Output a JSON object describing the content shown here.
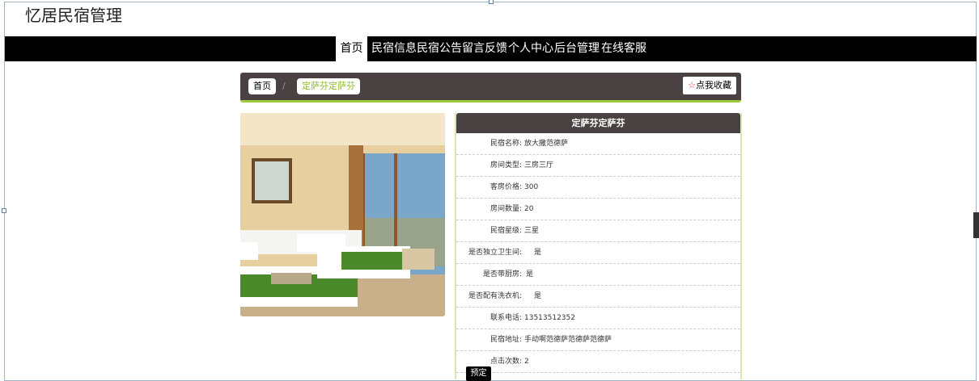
{
  "header": {
    "site_title": "忆居民宿管理"
  },
  "nav": {
    "items": [
      {
        "label": "首页",
        "active": true
      },
      {
        "label": "民宿信息"
      },
      {
        "label": "民宿公告"
      },
      {
        "label": "留言反馈"
      },
      {
        "label": "个人中心"
      },
      {
        "label": "后台管理"
      },
      {
        "label": "在线客服"
      }
    ]
  },
  "breadcrumb": {
    "home": "首页",
    "separator": "/",
    "current": "定萨芬定萨芬",
    "favorite_label": "点我收藏",
    "favorite_icon": "star-icon"
  },
  "detail": {
    "title": "定萨芬定萨芬",
    "rows": [
      {
        "label": "民宿名称:",
        "value": "放大撒范德萨"
      },
      {
        "label": "房间类型:",
        "value": "三房三厅"
      },
      {
        "label": "客房价格:",
        "value": "300"
      },
      {
        "label": "房间数量:",
        "value": "20"
      },
      {
        "label": "民宿星级:",
        "value": "三星"
      },
      {
        "label": "是否独立卫生间:",
        "value": "是"
      },
      {
        "label": "是否带厨房:",
        "value": "是"
      },
      {
        "label": "是否配有洗衣机:",
        "value": "是"
      },
      {
        "label": "联系电话:",
        "value": "13513512352"
      },
      {
        "label": "民宿地址:",
        "value": "手动啊范德萨范德萨范德萨"
      },
      {
        "label": "点击次数:",
        "value": "2"
      }
    ],
    "book_label": "预定"
  },
  "colors": {
    "nav_bg": "#000000",
    "bar_bg": "#4a4242",
    "accent": "#9ccc3c"
  }
}
